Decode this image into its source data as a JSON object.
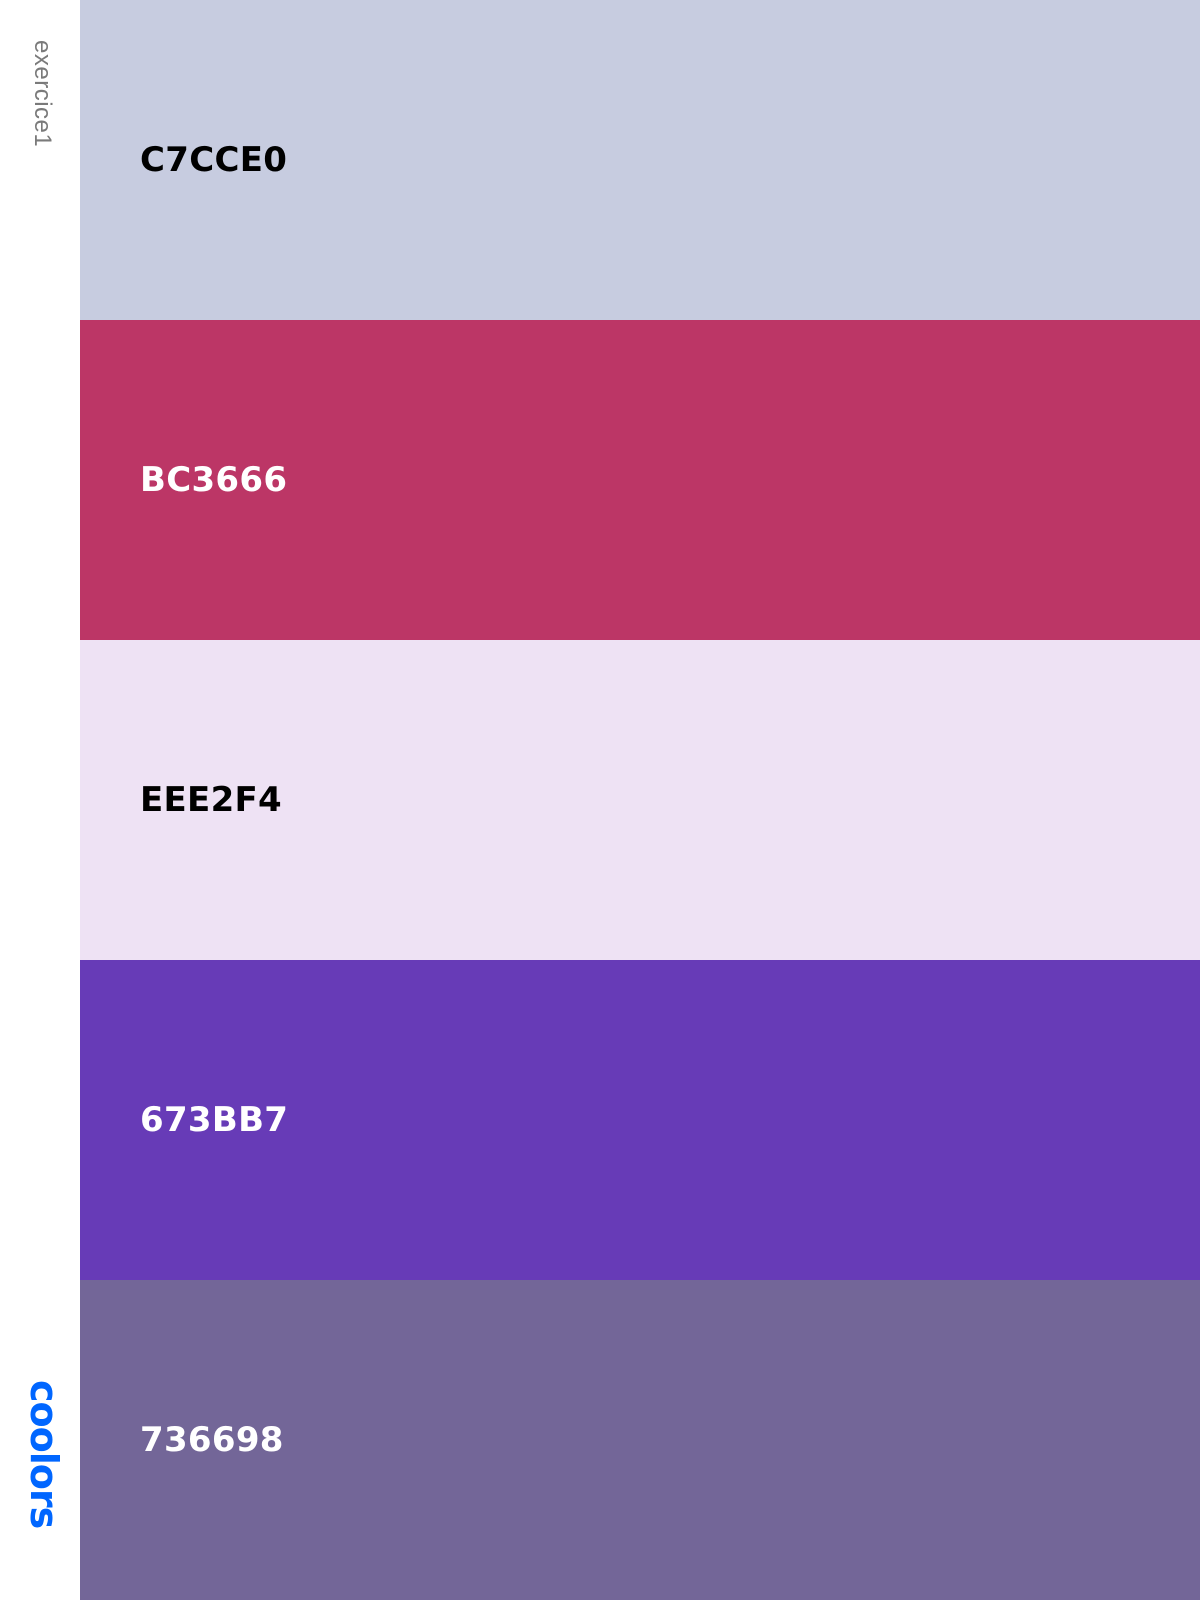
{
  "sidebar": {
    "palette_name": "exercice1",
    "logo_text": "coolors",
    "logo_color": "#0066ff"
  },
  "swatches": [
    {
      "code": "C7CCE0",
      "color": "#C7CCE0",
      "text_color": "#000000"
    },
    {
      "code": "BC3666",
      "color": "#BC3666",
      "text_color": "#ffffff"
    },
    {
      "code": "EEE2F4",
      "color": "#EEE2F4",
      "text_color": "#000000"
    },
    {
      "code": "673BB7",
      "color": "#673BB7",
      "text_color": "#ffffff"
    },
    {
      "code": "736698",
      "color": "#736698",
      "text_color": "#ffffff"
    }
  ]
}
